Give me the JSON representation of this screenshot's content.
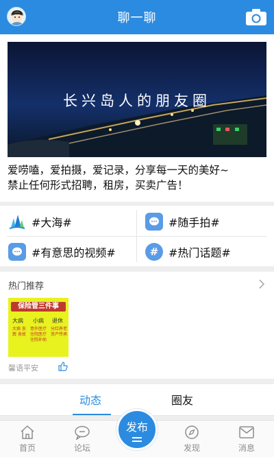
{
  "header": {
    "title": "聊一聊"
  },
  "banner": {
    "overlay_text": "长兴岛人的朋友圈",
    "description_line1": "爱唠嗑，爱拍摄，爱记录，分享每一天的美好~",
    "description_line2": "禁止任何形式招聘，租房，买卖广告！"
  },
  "topics": [
    {
      "label": "#大海#",
      "icon": "sea-icon"
    },
    {
      "label": "#随手拍#",
      "icon": "chat-bubble-icon"
    },
    {
      "label": "#有意思的视频#",
      "icon": "chat-bubble-icon"
    },
    {
      "label": "#热门话题#",
      "icon": "hashtag-icon"
    }
  ],
  "recommend": {
    "title": "热门推荐",
    "item_caption": "馨语平安",
    "thumb_text": {
      "headline": "保险管三件事",
      "c1": "大病",
      "c2": "小病",
      "c3": "退休",
      "d1": "大病 丧葬 身故",
      "d2": "意外医疗 住院医疗 住院补助",
      "d3": "分红养老 资产传承"
    }
  },
  "tabs": {
    "active": "动态",
    "other": "圈友"
  },
  "bottom_nav": {
    "home": "首页",
    "forum": "论坛",
    "publish": "发布",
    "discover": "发现",
    "messages": "消息"
  },
  "colors": {
    "accent": "#2b8be0"
  }
}
